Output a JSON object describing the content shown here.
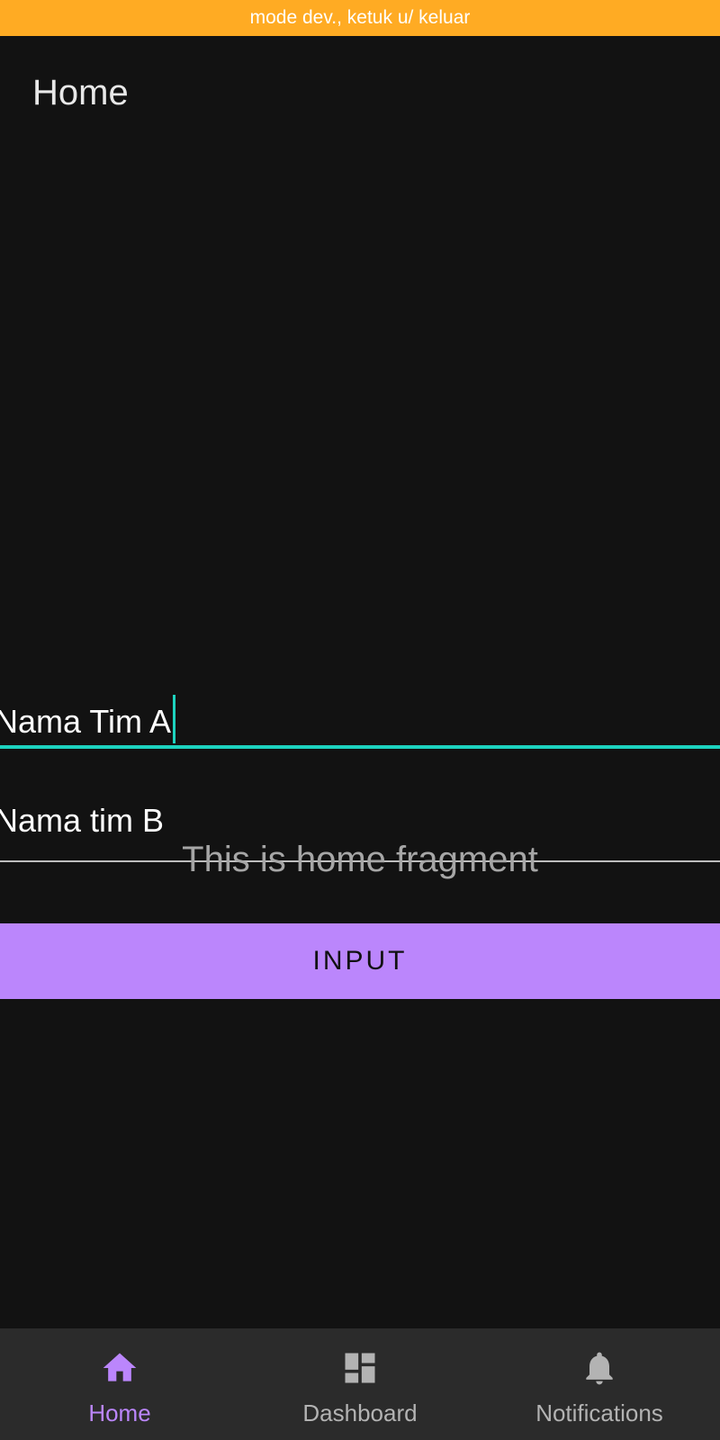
{
  "status_banner": {
    "text": "mode dev., ketuk u/ keluar",
    "color": "#FFAB23"
  },
  "app_bar": {
    "title": "Home"
  },
  "form": {
    "team_a": {
      "value": "Nama Tim A",
      "focused": true,
      "accent": "#1DD3BF"
    },
    "team_b": {
      "value": "Nama tim B"
    },
    "submit_label": "INPUT",
    "button_color": "#BB86FC"
  },
  "fragment": {
    "text": "This is home fragment"
  },
  "bottom_nav": {
    "items": [
      {
        "label": "Home",
        "icon": "home-icon",
        "selected": true,
        "color": "#BB86FC"
      },
      {
        "label": "Dashboard",
        "icon": "dashboard-icon",
        "selected": false,
        "color": "#B3B3B3"
      },
      {
        "label": "Notifications",
        "icon": "bell-icon",
        "selected": false,
        "color": "#B3B3B3"
      }
    ]
  }
}
